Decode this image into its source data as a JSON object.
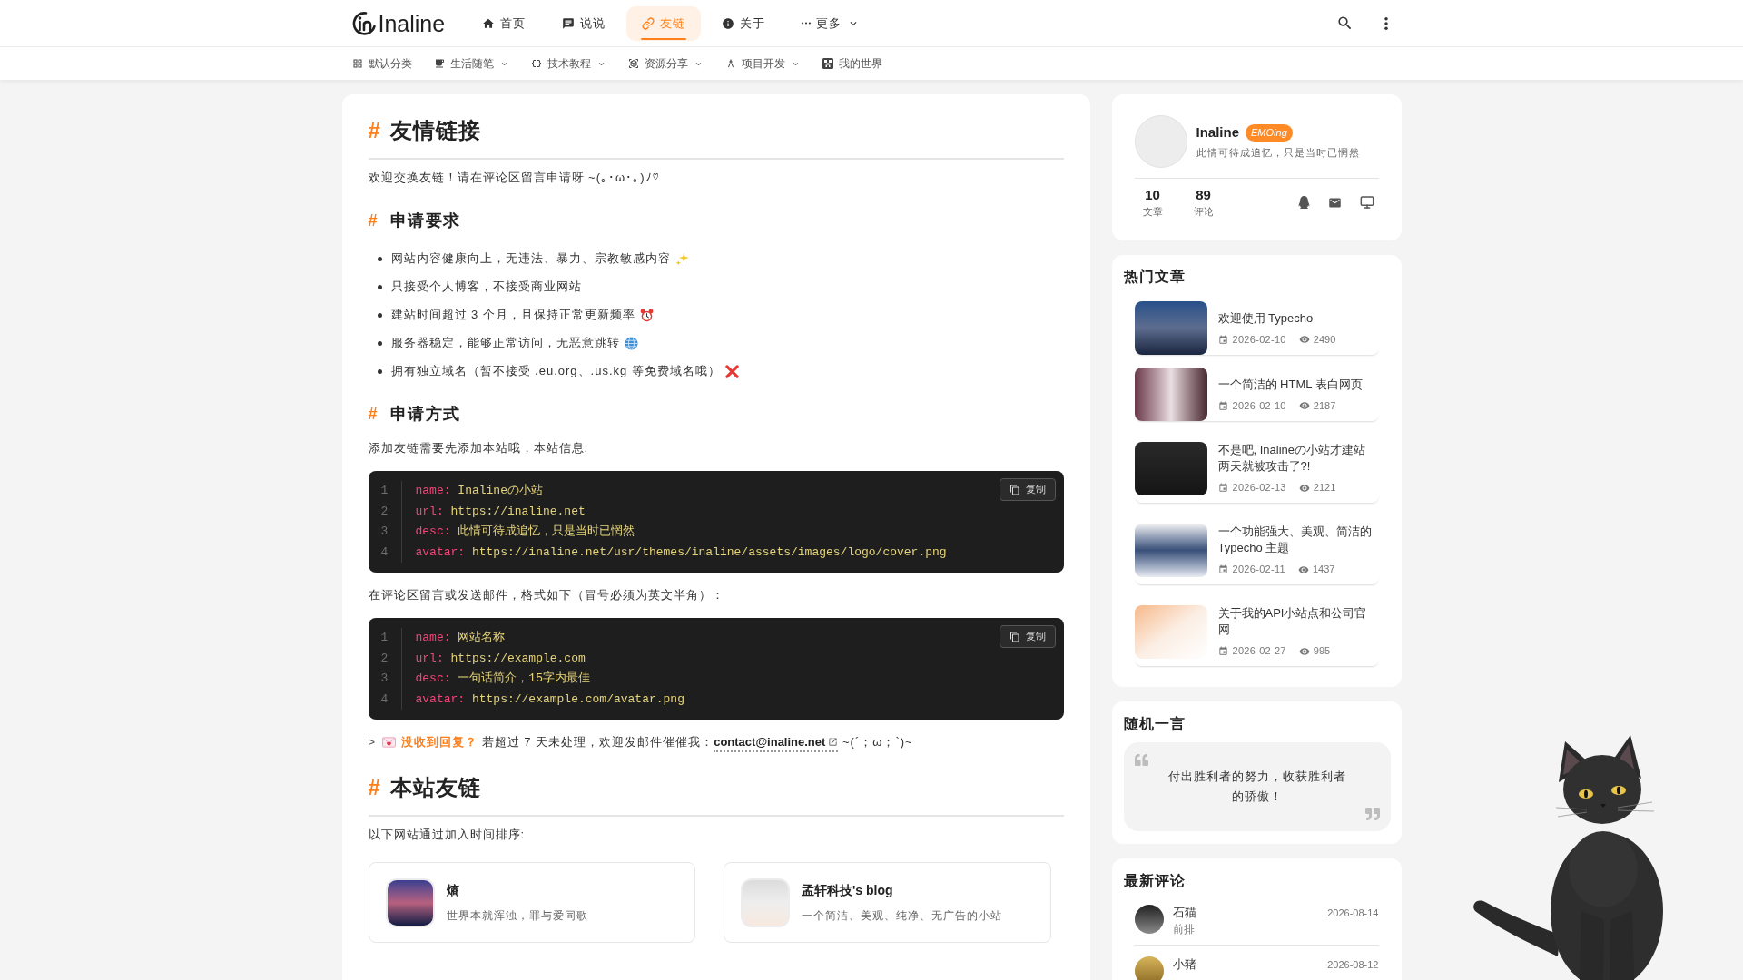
{
  "header": {
    "logo": "Inaline",
    "nav": [
      {
        "label": "首页",
        "selected": false,
        "dropdown": false
      },
      {
        "label": "说说",
        "selected": false,
        "dropdown": false
      },
      {
        "label": "友链",
        "selected": true,
        "dropdown": false
      },
      {
        "label": "关于",
        "selected": false,
        "dropdown": false
      },
      {
        "label": "更多",
        "selected": false,
        "dropdown": true
      }
    ]
  },
  "categories": [
    {
      "label": "默认分类",
      "dropdown": false
    },
    {
      "label": "生活随笔",
      "dropdown": true
    },
    {
      "label": "技术教程",
      "dropdown": true
    },
    {
      "label": "资源分享",
      "dropdown": true
    },
    {
      "label": "项目开发",
      "dropdown": true
    },
    {
      "label": "我的世界",
      "dropdown": false
    }
  ],
  "article": {
    "blocks": [
      {
        "kind": "title",
        "marker": "#",
        "text": "友情链接"
      },
      {
        "kind": "paragraph",
        "text": "欢迎交换友链！请在评论区留言申请呀 ~(｡･ω･｡)ﾉ♡"
      },
      {
        "kind": "heading",
        "marker": "#",
        "text": "申请要求"
      },
      {
        "kind": "list",
        "items": [
          "网站内容健康向上，无违法、暴力、宗教敏感内容",
          "只接受个人博客，不接受商业网站",
          "建站时间超过 3 个月，且保持正常更新频率",
          "服务器稳定，能够正常访问，无恶意跳转",
          "拥有独立域名（暂不接受 .eu.org、.us.kg 等免费域名哦）"
        ]
      },
      {
        "kind": "heading",
        "marker": "#",
        "text": "申请方式"
      },
      {
        "kind": "paragraph",
        "text": "添加友链需要先添加本站哦，本站信息:"
      },
      {
        "kind": "code",
        "copy_label": "复制",
        "lines": [
          {
            "number": "1",
            "key": "name:",
            "value": "Inalineの小站"
          },
          {
            "number": "2",
            "key": "url:",
            "value": "https://inaline.net"
          },
          {
            "number": "3",
            "key": "desc:",
            "value": "此情可待成追忆，只是当时已惘然"
          },
          {
            "number": "4",
            "key": "avatar:",
            "value": "https://inaline.net/usr/themes/inaline/assets/images/logo/cover.png"
          }
        ]
      },
      {
        "kind": "paragraph",
        "text": "在评论区留言或发送邮件，格式如下（冒号必须为英文半角）："
      },
      {
        "kind": "code",
        "copy_label": "复制",
        "lines": [
          {
            "number": "1",
            "key": "name:",
            "value": "网站名称"
          },
          {
            "number": "2",
            "key": "url:",
            "value": "https://example.com"
          },
          {
            "number": "3",
            "key": "desc:",
            "value": "一句话简介，15字内最佳"
          },
          {
            "number": "4",
            "key": "avatar:",
            "value": "https://example.com/avatar.png"
          }
        ]
      },
      {
        "kind": "note",
        "prefix": ">",
        "text": "**没收到回复？** 若超过 7 天未处理，欢迎发邮件催催我：",
        "link": "contact@inaline.net",
        "suffix": "~(´；ω；`)~"
      },
      {
        "kind": "title",
        "marker": "#",
        "text": "本站友链"
      },
      {
        "kind": "paragraph",
        "text": "以下网站通过加入时间排序:"
      },
      {
        "kind": "links",
        "items": [
          {
            "name": "熵",
            "description": "世界本就浑浊，罪与爱同歌"
          },
          {
            "name": "孟轩科技's blog",
            "description": "一个简洁、美观、纯净、无广告的小站"
          }
        ]
      }
    ]
  },
  "sidebar": {
    "profile": {
      "name": "Inaline",
      "badge": "EMOing",
      "motto": "此情可待成追忆，只是当时已惘然",
      "stats": [
        {
          "value": "10",
          "label": "文章"
        },
        {
          "value": "89",
          "label": "评论"
        }
      ]
    },
    "hot_articles": {
      "title": "热门文章",
      "items": [
        {
          "title": "欢迎使用 Typecho",
          "date": "2026-02-10",
          "views": "2490"
        },
        {
          "title": "一个简洁的 HTML 表白网页",
          "date": "2026-02-10",
          "views": "2187"
        },
        {
          "title": "不是吧, Inalineの小站才建站两天就被攻击了?!",
          "date": "2026-02-13",
          "views": "2121"
        },
        {
          "title": "一个功能强大、美观、简洁的 Typecho 主题",
          "date": "2026-02-11",
          "views": "1437"
        },
        {
          "title": "关于我的API小站点和公司官网",
          "date": "2026-02-27",
          "views": "995"
        }
      ]
    },
    "quote": {
      "title": "随机一言",
      "text": "付出胜利者的努力，收获胜利者的骄傲！"
    },
    "comments": {
      "title": "最新评论",
      "items": [
        {
          "author": "石猫",
          "text": "前排",
          "date": "2026-08-14"
        },
        {
          "author": "小猪",
          "date": "2026-08-12"
        }
      ]
    }
  }
}
